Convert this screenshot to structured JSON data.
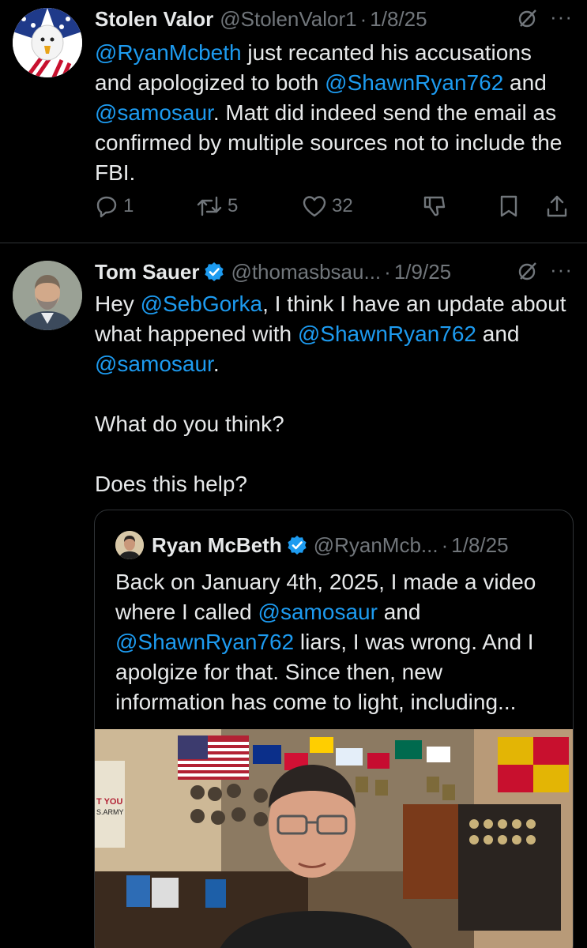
{
  "tweet1": {
    "author_name": "Stolen Valor",
    "handle": "@StolenValor1",
    "date": "1/8/25",
    "body": {
      "m1": "@RyanMcbeth",
      "t1": " just recanted his accusations and apologized to both ",
      "m2": "@ShawnRyan762",
      "t2": " and ",
      "m3": "@samosaur",
      "t3": ". Matt did indeed send the email as confirmed by multiple sources not to include the FBI."
    },
    "replies": "1",
    "reposts": "5",
    "likes": "32"
  },
  "tweet2": {
    "author_name": "Tom Sauer",
    "handle": "@thomasbsau...",
    "date": "1/9/25",
    "body": {
      "t0": "Hey ",
      "m1": "@SebGorka",
      "t1": ", I think I have an update about what happened with ",
      "m2": "@ShawnRyan762",
      "t2": " and ",
      "m3": "@samosaur",
      "t3": ".",
      "p2": "What do you think?",
      "p3": "Does this help?"
    }
  },
  "quoted": {
    "author_name": "Ryan McBeth",
    "handle": "@RyanMcb...",
    "date": "1/8/25",
    "body": {
      "t0": "Back on January 4th, 2025, I made a video where I called ",
      "m1": "@samosaur",
      "t1": " and ",
      "m2": "@ShawnRyan762",
      "t2": " liars, I was wrong. And I apolgize for that. Since then, new information has come to light, including..."
    },
    "media_sign_text": "T YOU\nS.ARMY"
  },
  "icons": {
    "reply": "reply-icon",
    "repost": "repost-icon",
    "like": "heart-icon",
    "downvote": "downvote-icon",
    "bookmark": "bookmark-icon",
    "share": "share-icon",
    "grok": "grok-icon",
    "more": "more-icon",
    "verified": "verified-badge-icon"
  },
  "colors": {
    "background": "#000000",
    "text": "#e7e9ea",
    "muted": "#71767b",
    "link": "#1d9bf0",
    "divider": "#2f3336"
  },
  "dot_separator": "·",
  "more_glyph": "···"
}
